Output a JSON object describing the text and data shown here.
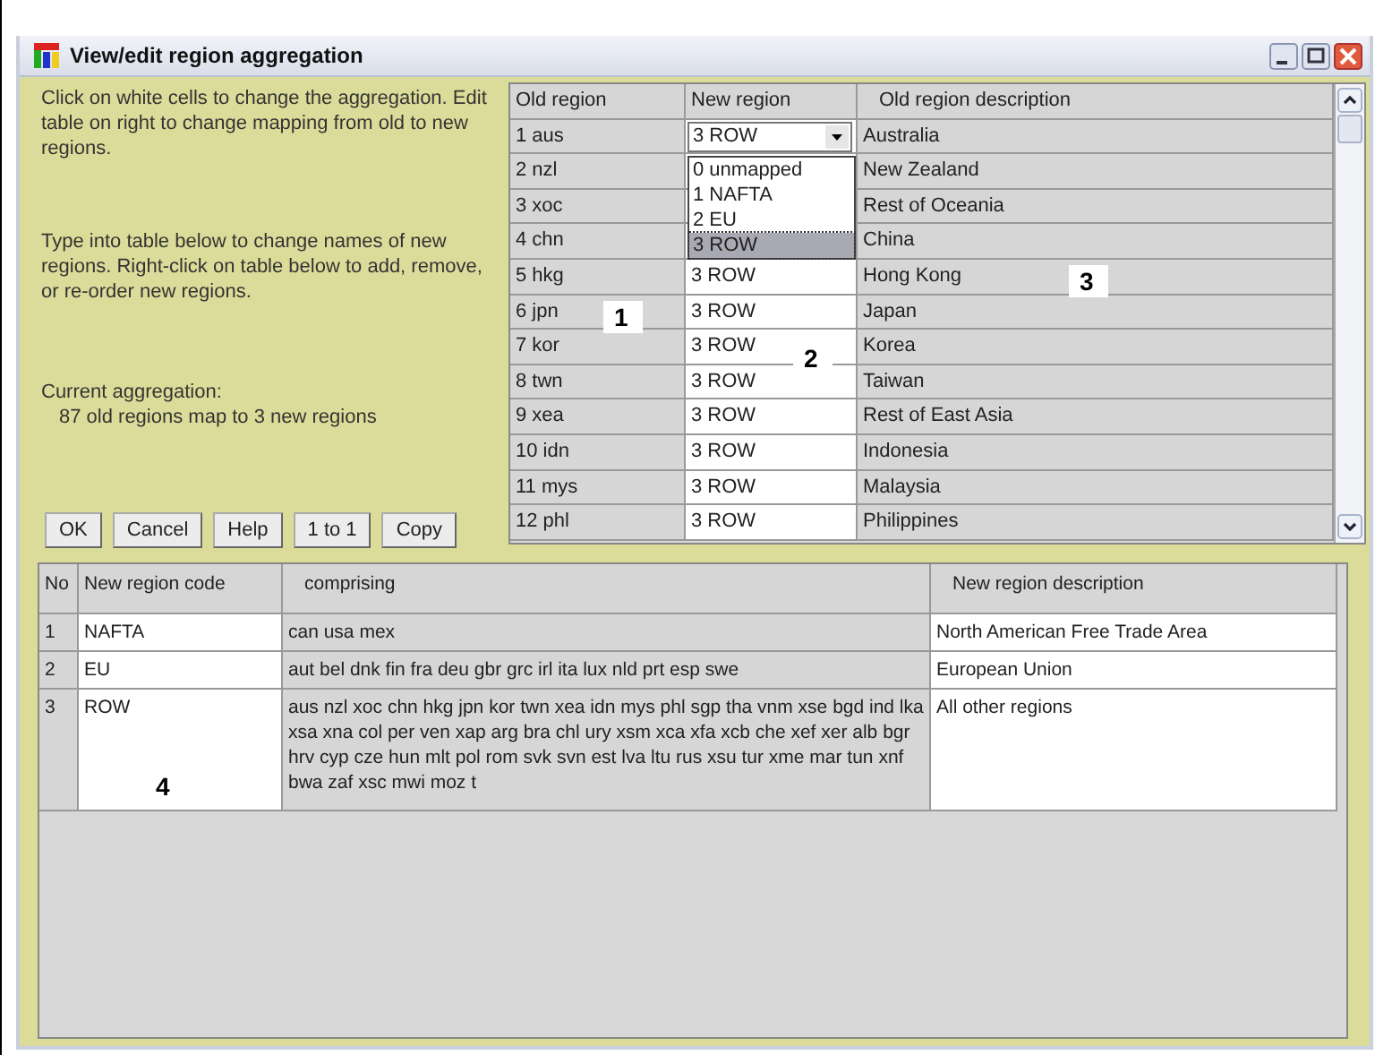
{
  "window": {
    "title": "View/edit region aggregation"
  },
  "instructions": [
    "Click on white cells to change the aggregation. Edit table on right to change mapping from old to new regions.",
    "Type into table below to change names of new regions. Right-click on table below to add, remove, or re-order new regions."
  ],
  "current_aggregation": {
    "label": "Current aggregation:",
    "summary": "87 old regions map to 3 new regions"
  },
  "buttons": [
    "OK",
    "Cancel",
    "Help",
    "1 to 1",
    "Copy"
  ],
  "mapping_table": {
    "columns": [
      "Old region",
      "New region",
      "Old region description"
    ],
    "dropdown": {
      "options": [
        {
          "label": "0 unmapped",
          "selected": false
        },
        {
          "label": "1 NAFTA",
          "selected": false
        },
        {
          "label": "2 EU",
          "selected": false
        },
        {
          "label": "3 ROW",
          "selected": true
        }
      ]
    },
    "rows": [
      {
        "old": "1 aus",
        "new": "3 ROW",
        "open": true,
        "description": "Australia"
      },
      {
        "old": "2 nzl",
        "description": "New Zealand"
      },
      {
        "old": "3 xoc",
        "description": "Rest of Oceania"
      },
      {
        "old": "4 chn",
        "description": "China"
      },
      {
        "old": "5 hkg",
        "new": "3 ROW",
        "description": "Hong Kong"
      },
      {
        "old": "6 jpn",
        "new": "3 ROW",
        "description": "Japan"
      },
      {
        "old": "7 kor",
        "new": "3 ROW",
        "description": "Korea"
      },
      {
        "old": "8 twn",
        "new": "3 ROW",
        "description": "Taiwan"
      },
      {
        "old": "9 xea",
        "new": "3 ROW",
        "description": "Rest of East Asia"
      },
      {
        "old": "10 idn",
        "new": "3 ROW",
        "description": "Indonesia"
      },
      {
        "old": "11 mys",
        "new": "3 ROW",
        "description": "Malaysia"
      },
      {
        "old": "12 phl",
        "new": "3 ROW",
        "description": "Philippines"
      }
    ]
  },
  "regions_table": {
    "columns": [
      "No",
      "New region code",
      "comprising",
      "New region description"
    ],
    "rows": [
      {
        "no": "1",
        "code": "NAFTA",
        "comprising": "can usa mex",
        "description": "North American Free Trade Area"
      },
      {
        "no": "2",
        "code": "EU",
        "comprising": "aut bel dnk fin fra deu gbr grc irl ita lux nld prt esp swe",
        "description": "European Union"
      },
      {
        "no": "3",
        "code": "ROW",
        "comprising": "aus nzl xoc chn hkg jpn kor twn xea idn mys phl sgp tha vnm xse bgd ind lka xsa xna col per ven xap arg bra chl ury xsm xca xfa xcb che xef xer alb bgr hrv cyp cze hun mlt pol rom svk svn est lva ltu rus xsu tur xme mar tun xnf bwa zaf xsc mwi moz t",
        "description": "All other regions"
      }
    ]
  },
  "callouts": [
    {
      "label": "1",
      "kind": "old"
    },
    {
      "label": "2",
      "kind": "new"
    },
    {
      "label": "3",
      "kind": "desc"
    },
    {
      "label": "4",
      "kind": "code"
    }
  ]
}
